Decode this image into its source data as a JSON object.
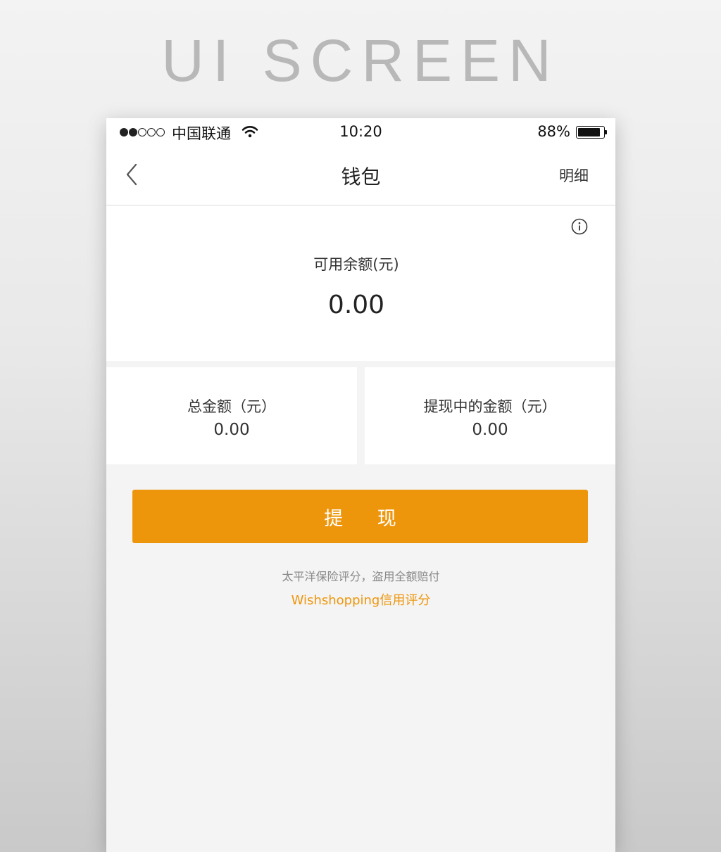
{
  "page_heading": "UI SCREEN",
  "status_bar": {
    "carrier": "中国联通",
    "time": "10:20",
    "battery_percent": "88%",
    "battery_level": 0.88,
    "signal_bars_filled": 2,
    "signal_bars_total": 5
  },
  "nav": {
    "title": "钱包",
    "detail_label": "明细",
    "back_icon": "chevron-left-icon"
  },
  "balance": {
    "label": "可用余额(元)",
    "value": "0.00",
    "info_icon": "info-icon"
  },
  "stats": [
    {
      "label": "总金额（元）",
      "value": "0.00"
    },
    {
      "label": "提现中的金额（元）",
      "value": "0.00"
    }
  ],
  "withdraw_button_label": "提 现",
  "insurance_note": "太平洋保险评分，盗用全额赔付",
  "credit_link": "Wishshopping信用评分",
  "colors": {
    "accent": "#ee960b",
    "background": "#f4f4f4",
    "card": "#ffffff"
  }
}
